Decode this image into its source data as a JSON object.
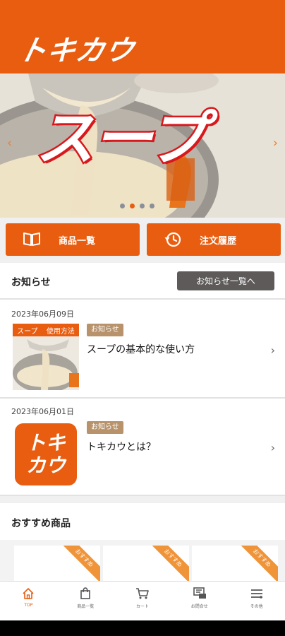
{
  "app": {
    "logo_text": "トキカウ",
    "accent_color": "#e85d10"
  },
  "hero": {
    "title": "スープ",
    "prev_icon": "chevron-left-icon",
    "next_icon": "chevron-right-icon",
    "slides_count": 4,
    "active_slide": 2
  },
  "quick_actions": [
    {
      "label": "商品一覧",
      "icon": "book-icon"
    },
    {
      "label": "注文履歴",
      "icon": "history-icon"
    }
  ],
  "news": {
    "title": "お知らせ",
    "all_button": "お知らせ一覧へ",
    "items": [
      {
        "date": "2023年06月09日",
        "badge": "お知らせ",
        "title": "スープの基本的な使い方",
        "thumb_tags": [
          "スープ",
          "使用方法"
        ]
      },
      {
        "date": "2023年06月01日",
        "badge": "お知らせ",
        "title": "トキカウとは？",
        "thumb_logo": [
          "トキ",
          "カウ"
        ]
      }
    ]
  },
  "recommended": {
    "title": "おすすめ商品",
    "ribbon_label": "おすすめ"
  },
  "tabbar": [
    {
      "label": "TOP",
      "icon": "home-icon",
      "active": true
    },
    {
      "label": "商品一覧",
      "icon": "shopping-bag-icon",
      "active": false
    },
    {
      "label": "カート",
      "icon": "cart-icon",
      "active": false
    },
    {
      "label": "お問合せ",
      "icon": "contact-icon",
      "active": false
    },
    {
      "label": "その他",
      "icon": "menu-icon",
      "active": false
    }
  ]
}
